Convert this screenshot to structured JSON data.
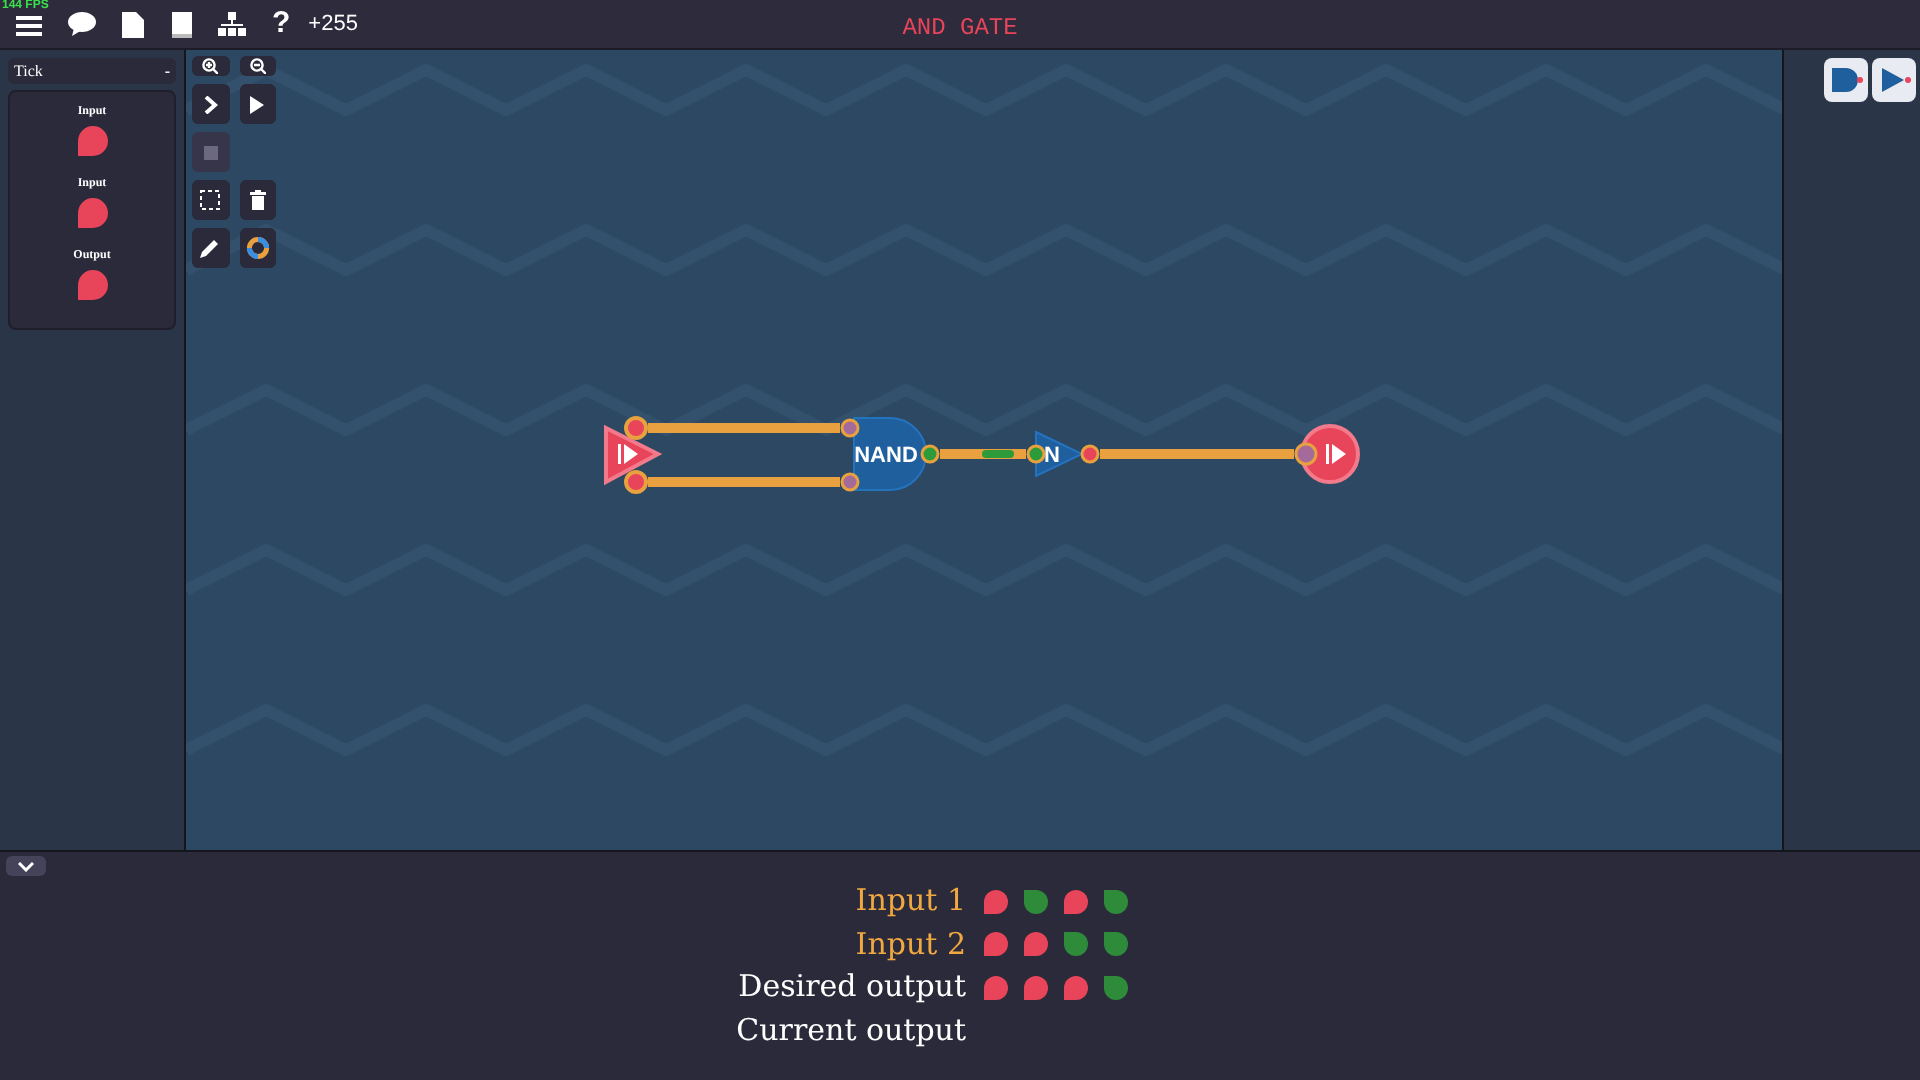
{
  "fps": "144 FPS",
  "toolbar": {
    "help": "?",
    "score": "+255"
  },
  "title": "AND GATE",
  "tick": {
    "label": "Tick",
    "toggle": "-"
  },
  "io_list": [
    {
      "label": "Input",
      "on": false
    },
    {
      "label": "Input",
      "on": false
    },
    {
      "label": "Output",
      "on": false
    }
  ],
  "circuit": {
    "gates": [
      {
        "label": "NAND"
      },
      {
        "label": "N"
      }
    ]
  },
  "truth_table": [
    {
      "label": "Input 1",
      "kind": "input",
      "states": [
        false,
        true,
        false,
        true
      ]
    },
    {
      "label": "Input 2",
      "kind": "input",
      "states": [
        false,
        false,
        true,
        true
      ]
    },
    {
      "label": "Desired output",
      "kind": "output",
      "states": [
        false,
        false,
        false,
        true
      ]
    },
    {
      "label": "Current output",
      "kind": "output"
    }
  ]
}
